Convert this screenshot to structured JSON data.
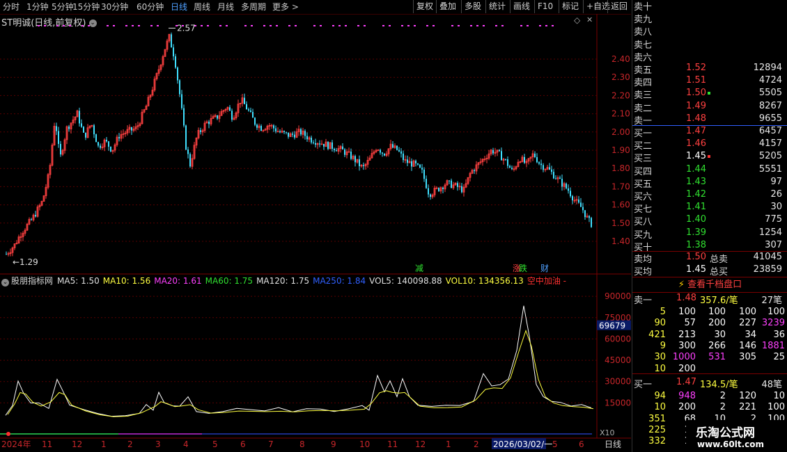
{
  "toolbar": {
    "periods": [
      "分时",
      "1分钟",
      "5分钟",
      "15分钟",
      "30分钟",
      "60分钟",
      "日线",
      "周线",
      "月线",
      "多周期",
      "更多 >"
    ],
    "active_period": "日线",
    "buttons": [
      "复权",
      "叠加",
      "多股",
      "统计",
      "画线",
      "F10",
      "标记",
      "+自选",
      "返回"
    ]
  },
  "stock": {
    "title": "ST明诚(日线,前复权)",
    "high_label": "2.57",
    "low_label": "1.29",
    "signals": [
      {
        "text": "减",
        "color": "#30e030"
      },
      {
        "text": "涨",
        "color": "#ff4040"
      },
      {
        "text": "跌",
        "color": "#30e030"
      },
      {
        "text": "财",
        "color": "#4fa0ff"
      }
    ]
  },
  "price_axis": [
    "2.40",
    "2.30",
    "2.20",
    "2.10",
    "2.00",
    "1.90",
    "1.80",
    "1.70",
    "1.60",
    "1.50",
    "1.40"
  ],
  "indicator": {
    "name": "股朋指标网",
    "items": [
      {
        "text": "MA5: 1.50",
        "color": "#e0e0e0"
      },
      {
        "text": "MA10: 1.56",
        "color": "#ffff40"
      },
      {
        "text": "MA20: 1.61",
        "color": "#ff40ff"
      },
      {
        "text": "MA60: 1.75",
        "color": "#30e030"
      },
      {
        "text": "MA120: 1.75",
        "color": "#e0e0e0"
      },
      {
        "text": "MA250: 1.84",
        "color": "#3060ff"
      },
      {
        "text": "VOL5: 140098.88",
        "color": "#e0e0e0"
      },
      {
        "text": "VOL10: 134356.13",
        "color": "#ffff40"
      },
      {
        "text": "空中加油 -",
        "color": "#ff3030"
      }
    ]
  },
  "volume_axis": [
    "90000",
    "75000",
    "60000",
    "45000",
    "30000",
    "15000"
  ],
  "volume_marker": "69679",
  "x10": "X10",
  "date_axis": [
    "2024年",
    "11",
    "12",
    "1",
    "2",
    "3",
    "4",
    "5",
    "6",
    "7",
    "8",
    "9",
    "10",
    "11",
    "12",
    "1",
    "2",
    "2026/03/02/一",
    "5",
    "6"
  ],
  "date_mode": "日线",
  "order_book": {
    "sells": [
      {
        "label": "卖十",
        "price": "",
        "vol": ""
      },
      {
        "label": "卖九",
        "price": "",
        "vol": ""
      },
      {
        "label": "卖八",
        "price": "",
        "vol": ""
      },
      {
        "label": "卖七",
        "price": "",
        "vol": ""
      },
      {
        "label": "卖六",
        "price": "",
        "vol": ""
      },
      {
        "label": "卖五",
        "price": "1.52",
        "vol": "12894"
      },
      {
        "label": "卖四",
        "price": "1.51",
        "vol": "4724"
      },
      {
        "label": "卖三",
        "price": "1.50",
        "vol": "5505"
      },
      {
        "label": "卖二",
        "price": "1.49",
        "vol": "8267"
      },
      {
        "label": "卖一",
        "price": "1.48",
        "vol": "9655"
      }
    ],
    "buys": [
      {
        "label": "买一",
        "price": "1.47",
        "vol": "6457",
        "color": "red"
      },
      {
        "label": "买二",
        "price": "1.46",
        "vol": "4157",
        "color": "red"
      },
      {
        "label": "买三",
        "price": "1.45",
        "vol": "5205",
        "color": "white"
      },
      {
        "label": "买四",
        "price": "1.44",
        "vol": "5551",
        "color": "green"
      },
      {
        "label": "买五",
        "price": "1.43",
        "vol": "97",
        "color": "green"
      },
      {
        "label": "买六",
        "price": "1.42",
        "vol": "26",
        "color": "green"
      },
      {
        "label": "买七",
        "price": "1.41",
        "vol": "30",
        "color": "green"
      },
      {
        "label": "买八",
        "price": "1.40",
        "vol": "775",
        "color": "green"
      },
      {
        "label": "买九",
        "price": "1.39",
        "vol": "1254",
        "color": "green"
      },
      {
        "label": "买十",
        "price": "1.38",
        "vol": "307",
        "color": "green"
      }
    ],
    "avg_sell": {
      "label": "卖均",
      "price": "1.50",
      "total_label": "总卖",
      "total": "41045"
    },
    "avg_buy": {
      "label": "买均",
      "price": "1.45",
      "total_label": "总买",
      "total": "23859"
    },
    "view_button": "查看千档盘口",
    "sell1_detail": {
      "label": "卖一",
      "price": "1.48",
      "per": "357.6/笔",
      "count": "27笔"
    },
    "sell1_orders": [
      [
        "5",
        "100",
        "100",
        "100",
        "100"
      ],
      [
        "90",
        "57",
        "200",
        "227",
        "3239"
      ],
      [
        "421",
        "213",
        "30",
        "34",
        "36"
      ],
      [
        "9",
        "300",
        "266",
        "146",
        "1881"
      ],
      [
        "30",
        "1000",
        "531",
        "305",
        "25"
      ],
      [
        "10",
        "200",
        "",
        "",
        ""
      ]
    ],
    "buy1_detail": {
      "label": "买一",
      "price": "1.47",
      "per": "134.5/笔",
      "count": "48笔"
    },
    "buy1_orders": [
      [
        "94",
        "948",
        "2",
        "120",
        "10"
      ],
      [
        "10",
        "200",
        "2",
        "221",
        "100"
      ],
      [
        "351",
        "68",
        "10",
        "2",
        "100"
      ],
      [
        "225",
        "10",
        "",
        "",
        ""
      ],
      [
        "332",
        "10",
        "",
        "",
        ""
      ]
    ]
  },
  "watermark": {
    "title": "乐淘公式网",
    "url": "www.60lt.com"
  }
}
